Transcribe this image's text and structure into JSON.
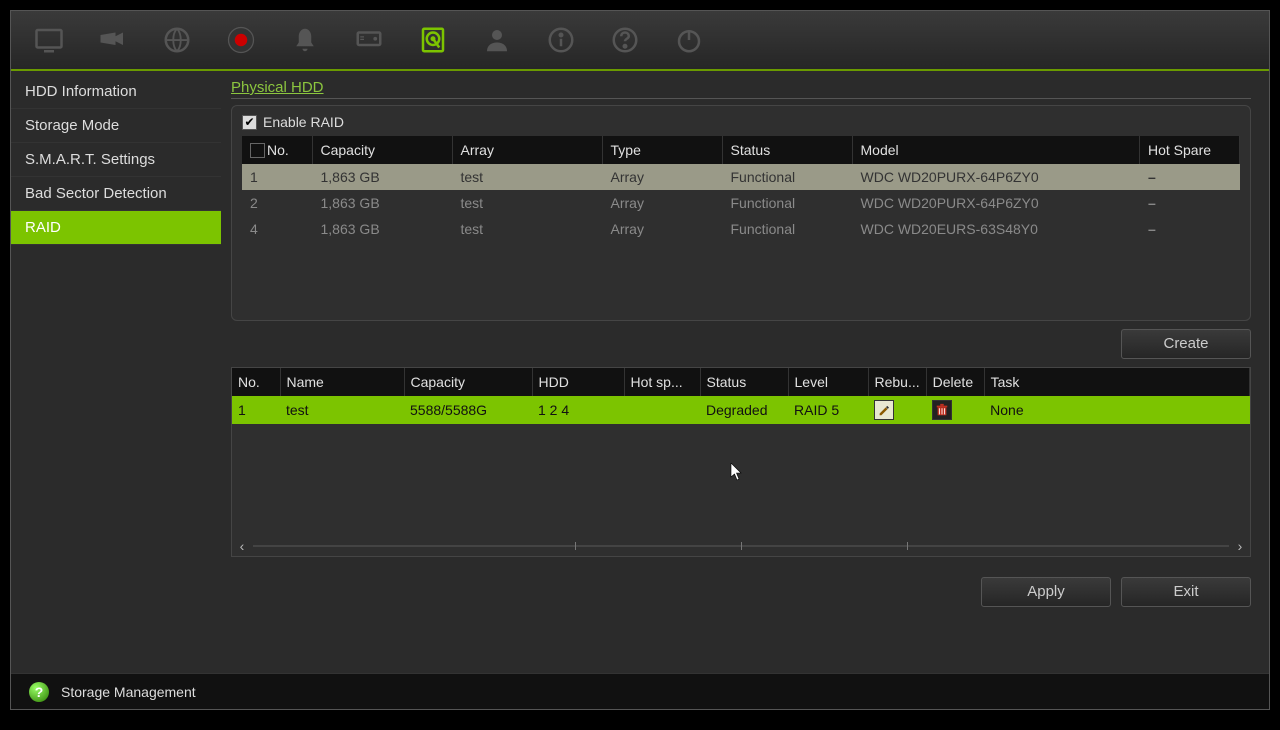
{
  "statusbar": {
    "title": "Storage Management"
  },
  "sidebar": {
    "items": [
      {
        "label": "HDD Information"
      },
      {
        "label": "Storage Mode"
      },
      {
        "label": "S.M.A.R.T. Settings"
      },
      {
        "label": "Bad Sector Detection"
      },
      {
        "label": "RAID",
        "active": true
      }
    ]
  },
  "page": {
    "title": "Physical HDD",
    "enable_label": "Enable RAID",
    "hdd_headers": {
      "no": "No.",
      "capacity": "Capacity",
      "array": "Array",
      "type": "Type",
      "status": "Status",
      "model": "Model",
      "hotspare": "Hot Spare"
    },
    "hdd_rows": [
      {
        "no": "1",
        "capacity": "1,863 GB",
        "array": "test",
        "type": "Array",
        "status": "Functional",
        "model": "WDC WD20PURX-64P6ZY0",
        "hotspare": "–",
        "selected": true
      },
      {
        "no": "2",
        "capacity": "1,863 GB",
        "array": "test",
        "type": "Array",
        "status": "Functional",
        "model": "WDC WD20PURX-64P6ZY0",
        "hotspare": "–"
      },
      {
        "no": "4",
        "capacity": "1,863 GB",
        "array": "test",
        "type": "Array",
        "status": "Functional",
        "model": "WDC WD20EURS-63S48Y0",
        "hotspare": "–"
      }
    ],
    "create_label": "Create",
    "arr_headers": {
      "no": "No.",
      "name": "Name",
      "capacity": "Capacity",
      "hdd": "HDD",
      "hotspare": "Hot sp...",
      "status": "Status",
      "level": "Level",
      "rebuild": "Rebu...",
      "delete": "Delete",
      "task": "Task"
    },
    "arr_rows": [
      {
        "no": "1",
        "name": "test",
        "capacity": "5588/5588G",
        "hdd": "1  2  4",
        "hotspare": "",
        "status": "Degraded",
        "level": "RAID 5",
        "task": "None"
      }
    ],
    "apply_label": "Apply",
    "exit_label": "Exit"
  }
}
